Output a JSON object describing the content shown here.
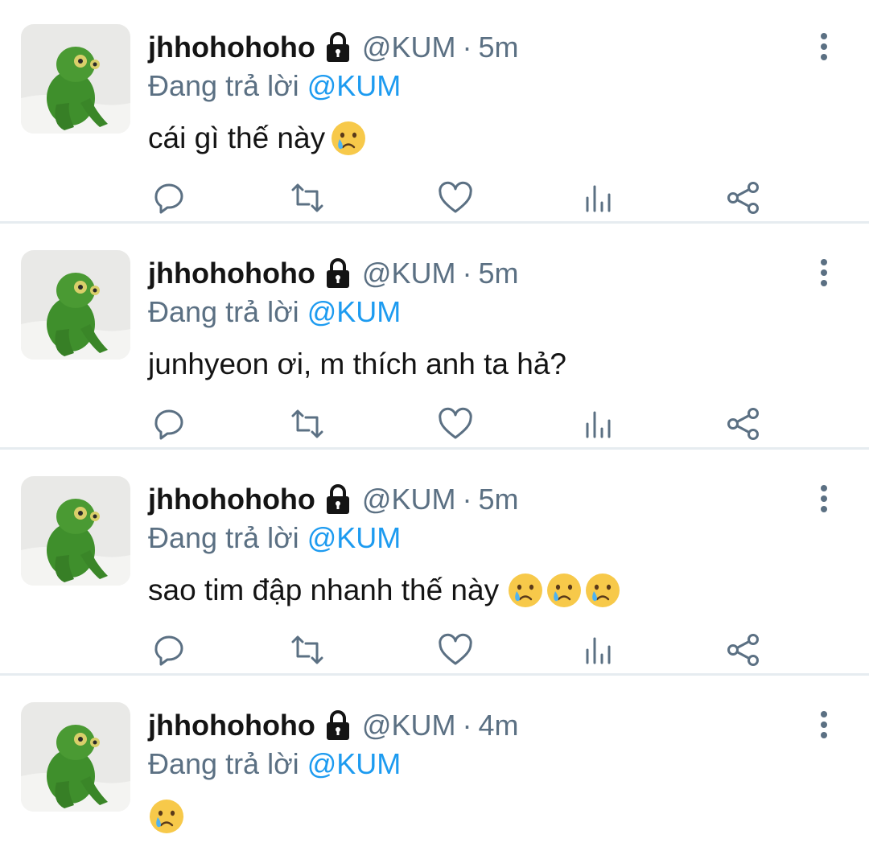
{
  "tweets": [
    {
      "name": "jhhohohoho",
      "handle": "@KUM",
      "separator": "·",
      "time": "5m",
      "replying_prefix": "Đang trả lời",
      "replying_to": "@KUM",
      "text": "cái gì thế này",
      "emoji_count": 1,
      "emoji": "crying-face"
    },
    {
      "name": "jhhohohoho",
      "handle": "@KUM",
      "separator": "·",
      "time": "5m",
      "replying_prefix": "Đang trả lời",
      "replying_to": "@KUM",
      "text": "junhyeon ơi, m thích anh ta hả?",
      "emoji_count": 0,
      "emoji": ""
    },
    {
      "name": "jhhohohoho",
      "handle": "@KUM",
      "separator": "·",
      "time": "5m",
      "replying_prefix": "Đang trả lời",
      "replying_to": "@KUM",
      "text": "sao tim đập nhanh thế này",
      "emoji_count": 3,
      "emoji": "crying-face"
    },
    {
      "name": "jhhohohoho",
      "handle": "@KUM",
      "separator": "·",
      "time": "4m",
      "replying_prefix": "Đang trả lời",
      "replying_to": "@KUM",
      "text": "",
      "emoji_count": 1,
      "emoji": "crying-face"
    }
  ],
  "icons": {
    "reply": "reply-icon",
    "retweet": "retweet-icon",
    "like": "heart-icon",
    "analytics": "analytics-icon",
    "share": "share-icon",
    "more": "more-vertical-icon",
    "protected": "lock-icon"
  },
  "colors": {
    "mention": "#1d9bf0",
    "secondary_text": "#5b7083",
    "action_icon": "#5b7083",
    "divider": "#e6ecf0"
  }
}
